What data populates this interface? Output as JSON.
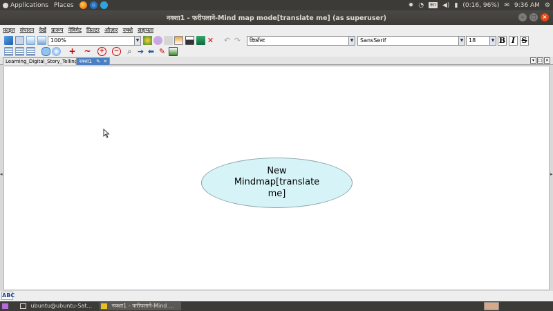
{
  "top_panel": {
    "applications": "Applications",
    "places": "Places",
    "keyboard": "En",
    "battery": "(0:16, 96%)",
    "time": "9:36 AM"
  },
  "window": {
    "title": "नक्शा1 - फरीपलाने-Mind map mode[translate me] (as superuser)"
  },
  "menubar": {
    "items": [
      "फ़ाइल",
      "संपादन",
      "देखें",
      "प्रारूप",
      "नेविगेट",
      "फ़िल्टर",
      "औज़ार",
      "नक्शे",
      "सहायता"
    ]
  },
  "toolbar": {
    "zoom": "100%",
    "style": "डिफ़ॉल्ट",
    "font": "SansSerif",
    "font_size": "18",
    "bold": "B",
    "italic": "I",
    "strike": "S"
  },
  "tabs": [
    {
      "label": "Learning_Digital_Story_Telling",
      "active": false
    },
    {
      "label": "नक्शा1",
      "active": true
    }
  ],
  "canvas": {
    "root_node_text": "New Mindmap[translate me]"
  },
  "statusbar": {
    "abc": "ABC"
  },
  "taskbar": {
    "terminal": "ubuntu@ubuntu-Sat...",
    "app": "नक्शा1 - फरीपलाने-Mind ..."
  },
  "colors": {
    "panel": "#3c3b37",
    "node_fill": "#d6f4f8",
    "active_tab": "#4a7fc3",
    "close_button": "#df4a16"
  }
}
